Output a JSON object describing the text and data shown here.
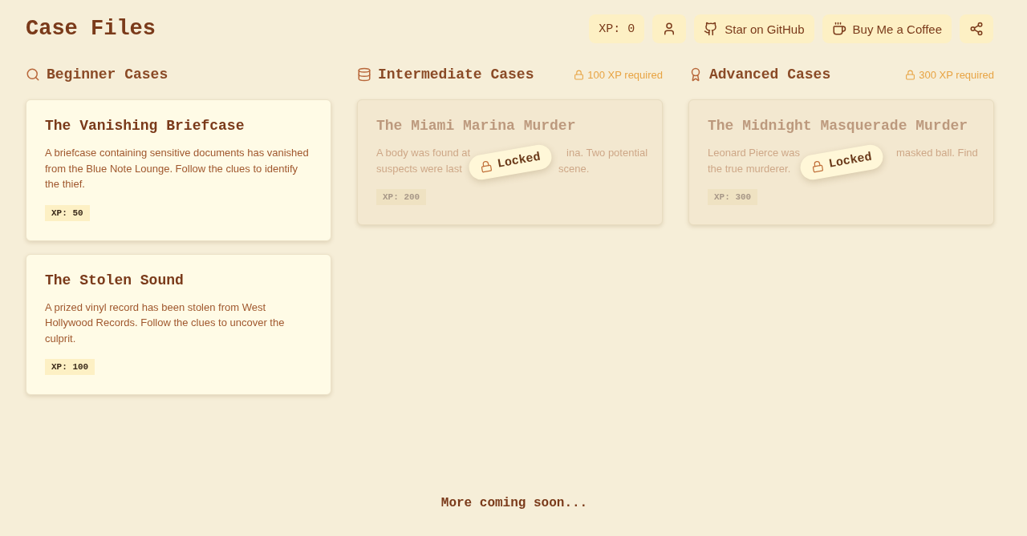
{
  "header": {
    "title": "Case Files",
    "xp": "XP: 0",
    "buttons": [
      {
        "kind": "profile"
      },
      {
        "kind": "github",
        "label": "Star on GitHub"
      },
      {
        "kind": "coffee",
        "label": "Buy Me a Coffee"
      },
      {
        "kind": "share"
      }
    ]
  },
  "sections": [
    {
      "title": "Beginner Cases",
      "locked": false,
      "cases": [
        {
          "title": "The Vanishing Briefcase",
          "description": "A briefcase containing sensitive documents has vanished from the Blue Note Lounge. Follow the clues to identify the thief.",
          "xp": "XP: 50"
        },
        {
          "title": "The Stolen Sound",
          "description": "A prized vinyl record has been stolen from West Hollywood Records. Follow the clues to uncover the culprit.",
          "xp": "XP: 100"
        }
      ]
    },
    {
      "title": "Intermediate Cases",
      "locked": true,
      "requirement": "100 XP required",
      "cases": [
        {
          "title": "The Miami Marina Murder",
          "description_lines": [
            [
              "A body was found at",
              "ina. Two potential"
            ],
            [
              "suspects were last",
              "scene."
            ]
          ],
          "xp": "XP: 200",
          "badge": "Locked"
        }
      ]
    },
    {
      "title": "Advanced Cases",
      "locked": true,
      "requirement": "300 XP required",
      "cases": [
        {
          "title": "The Midnight Masquerade Murder",
          "description_lines": [
            [
              "Leonard Pierce was",
              "masked ball. Find"
            ],
            [
              "the true murderer."
            ]
          ],
          "xp": "XP: 300",
          "badge": "Locked"
        }
      ]
    }
  ],
  "footer": "More coming soon..."
}
